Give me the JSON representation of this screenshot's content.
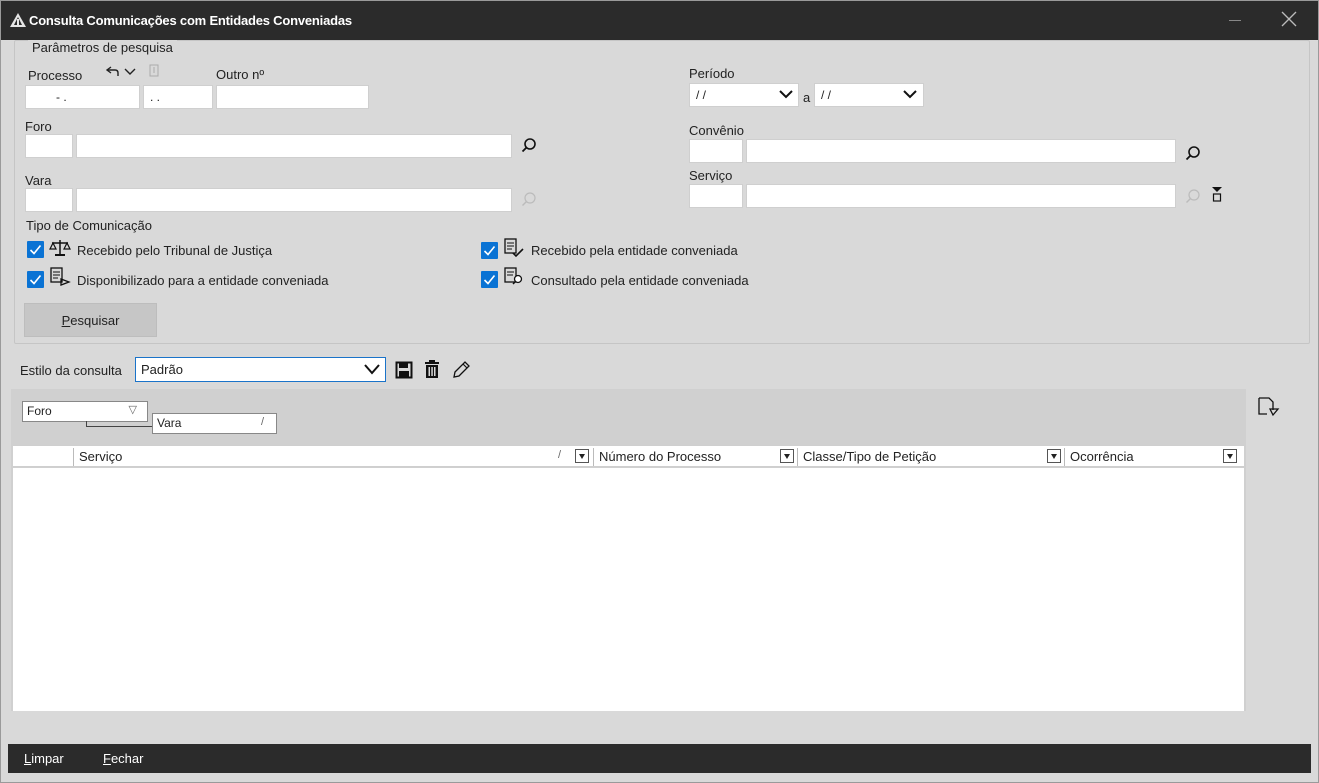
{
  "window": {
    "title": "Consulta Comunicações com Entidades Conveniadas"
  },
  "params": {
    "legend": "Parâmetros de pesquisa",
    "processo_label": "Processo",
    "processo_mask1": "- .",
    "processo_mask2": ". .",
    "outro_label": "Outro nº",
    "foro_label": "Foro",
    "vara_label": "Vara",
    "periodo_label": "Período",
    "periodo_start": "/ /",
    "periodo_sep": "a",
    "periodo_end": "/ /",
    "convenio_label": "Convênio",
    "servico_label": "Serviço",
    "tipo_label": "Tipo de Comunicação",
    "checks": [
      {
        "label": "Recebido pelo Tribunal de Justiça",
        "checked": true,
        "icon": "scales-icon"
      },
      {
        "label": "Recebido pela entidade conveniada",
        "checked": true,
        "icon": "document-check-icon"
      },
      {
        "label": "Disponibilizado para a entidade conveniada",
        "checked": true,
        "icon": "document-send-icon"
      },
      {
        "label": "Consultado pela entidade conveniada",
        "checked": true,
        "icon": "document-search-icon"
      }
    ],
    "search_button": "Pesquisar",
    "search_hotkey": "P",
    "search_rest": "esquisar"
  },
  "style": {
    "label": "Estilo da consulta",
    "value": "Padrão"
  },
  "grid": {
    "group_foro": "Foro",
    "group_vara": "Vara",
    "columns": [
      "Serviço",
      "Número do Processo",
      "Classe/Tipo de Petição",
      "Ocorrência"
    ]
  },
  "footer": {
    "limpar_hotkey": "L",
    "limpar_rest": "impar",
    "fechar_hotkey": "F",
    "fechar_rest": "echar"
  },
  "colors": {
    "titlebar": "#2b2b2b",
    "accent": "#0a73d4",
    "background": "#d9d9d9"
  }
}
